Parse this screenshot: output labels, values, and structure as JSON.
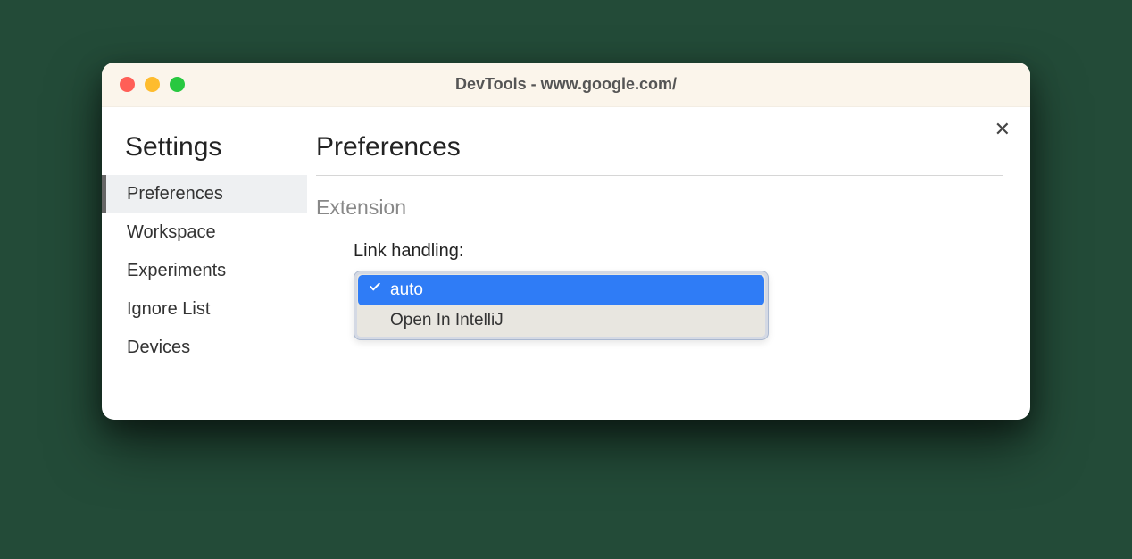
{
  "window": {
    "title": "DevTools - www.google.com/"
  },
  "sidebar": {
    "title": "Settings",
    "items": [
      {
        "label": "Preferences",
        "active": true
      },
      {
        "label": "Workspace",
        "active": false
      },
      {
        "label": "Experiments",
        "active": false
      },
      {
        "label": "Ignore List",
        "active": false
      },
      {
        "label": "Devices",
        "active": false
      }
    ]
  },
  "main": {
    "title": "Preferences",
    "section_title": "Extension",
    "setting_label": "Link handling:",
    "dropdown": {
      "options": [
        {
          "label": "auto",
          "selected": true
        },
        {
          "label": "Open In IntelliJ",
          "selected": false
        }
      ]
    }
  }
}
